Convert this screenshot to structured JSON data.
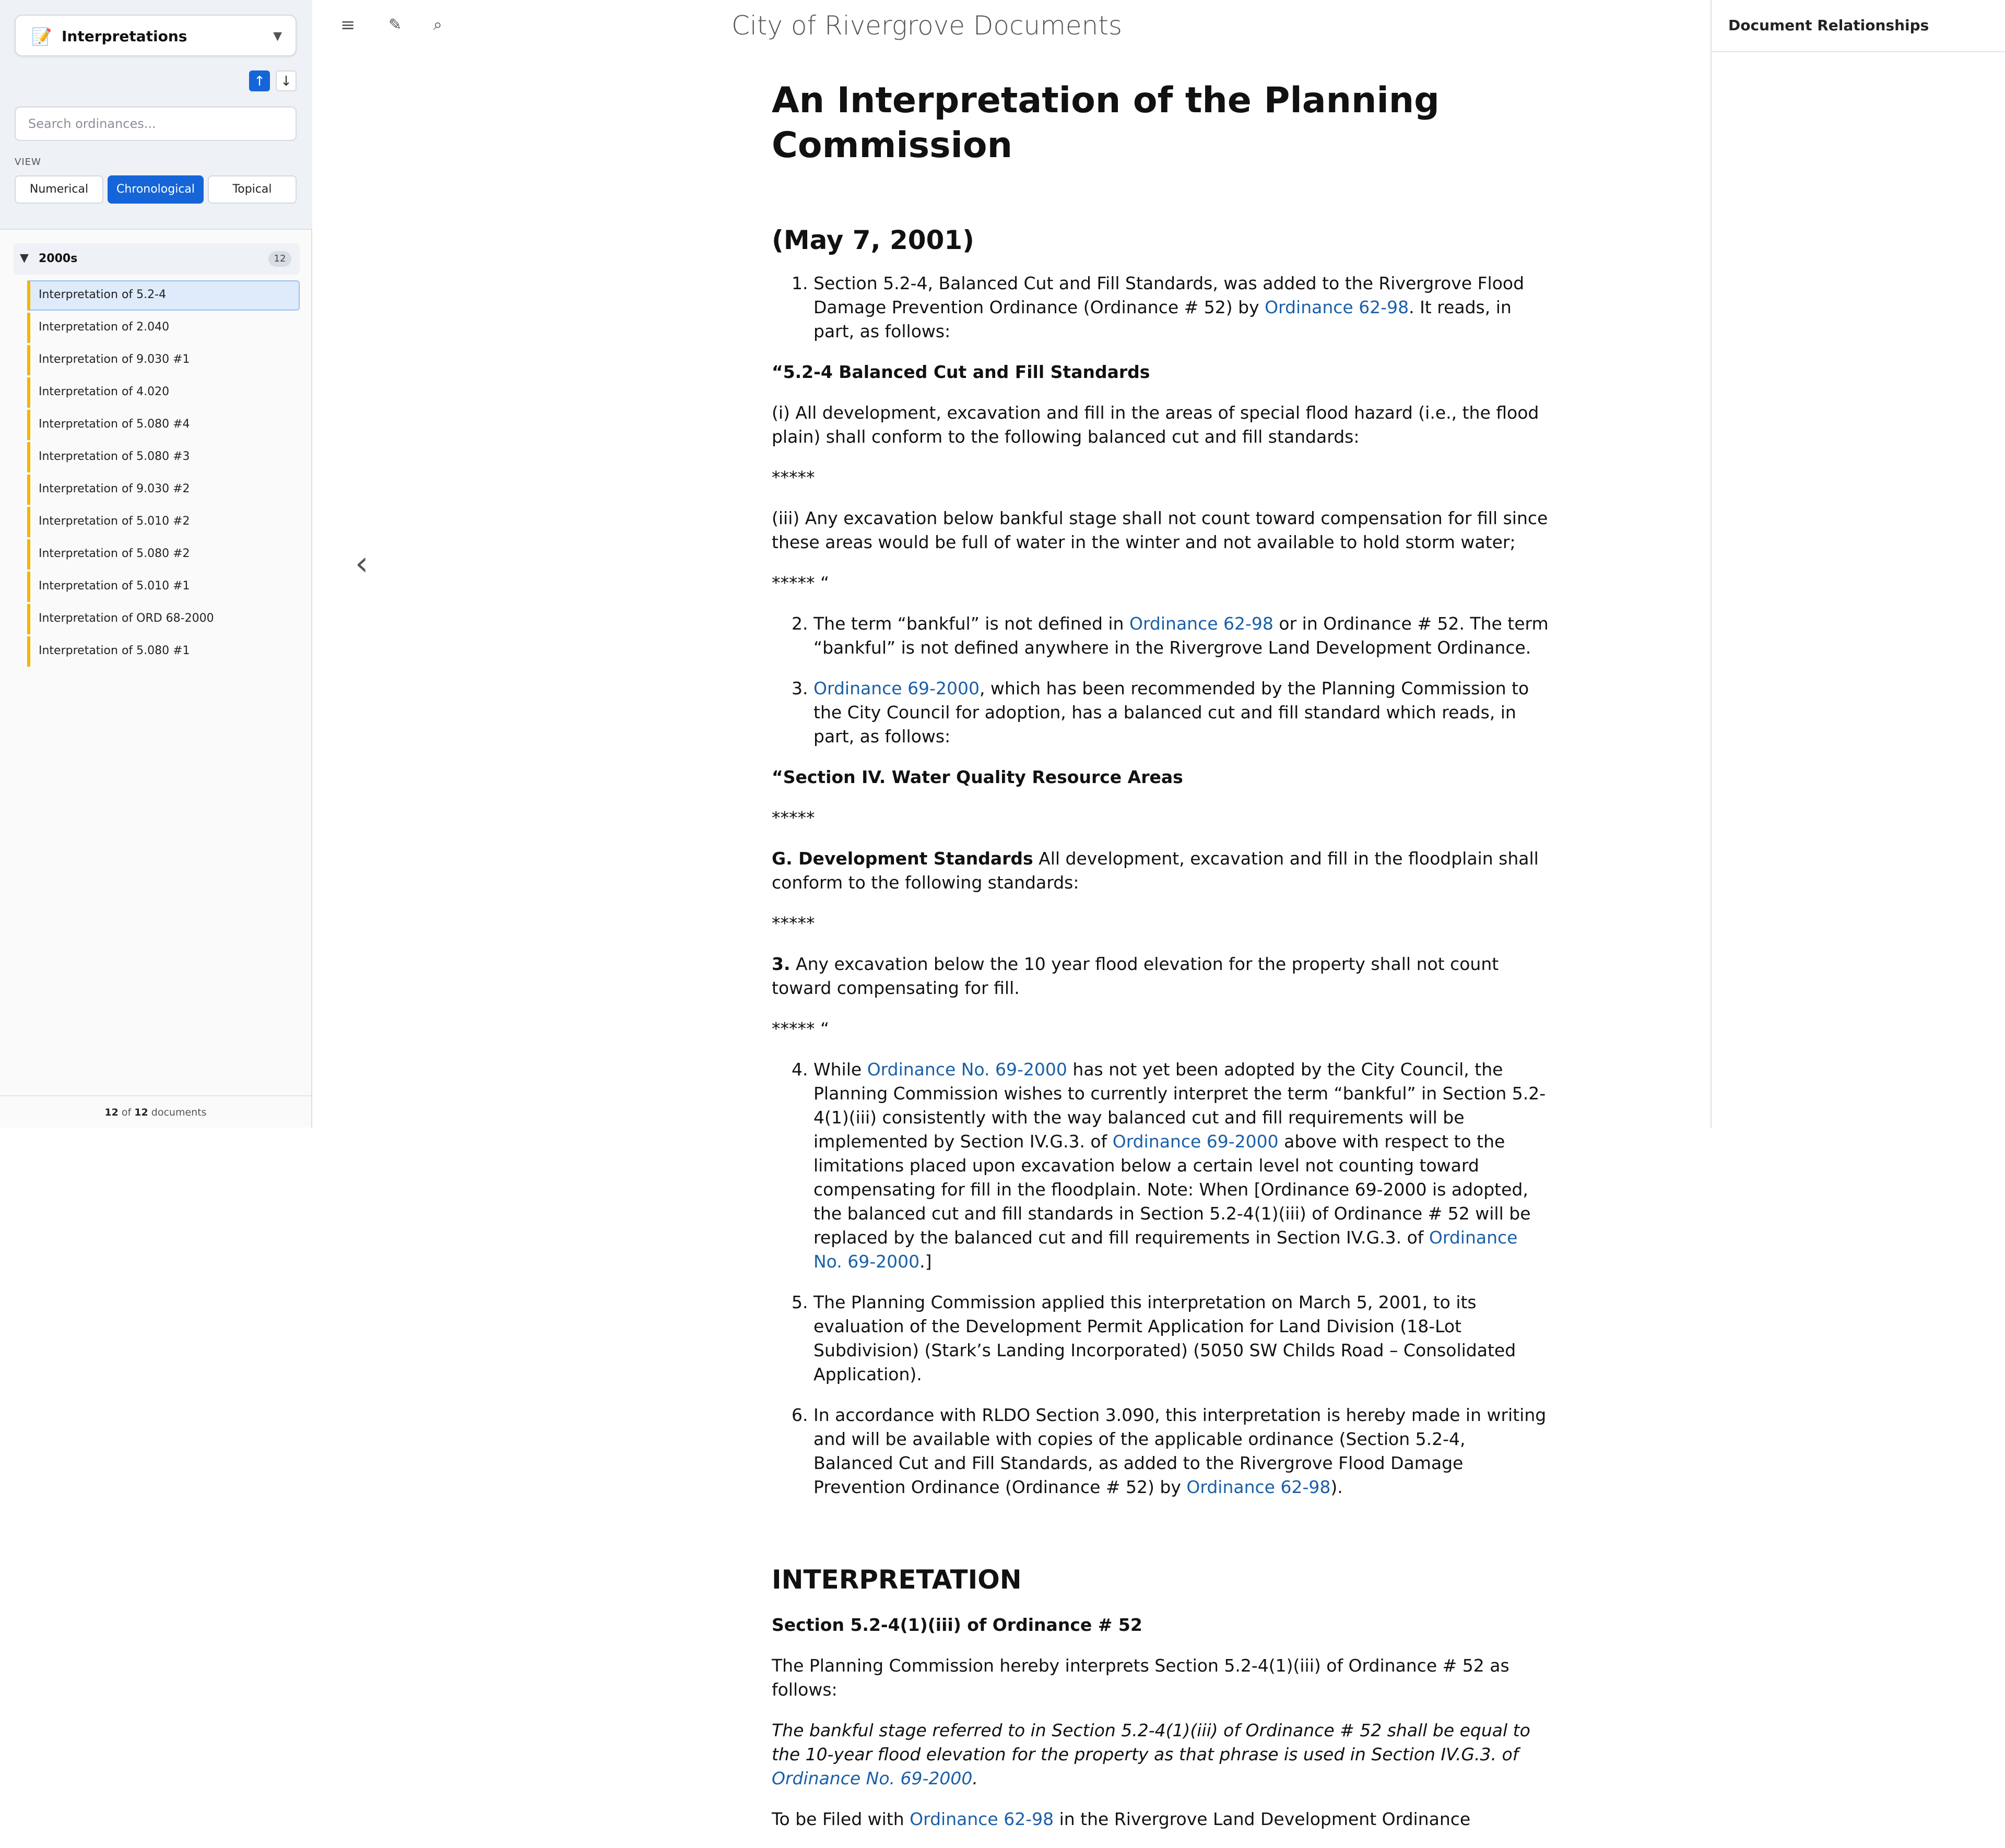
{
  "sidebar": {
    "collection_icon": "📝",
    "collection_label": "Interpretations",
    "caret": "▼",
    "sort_up": "↑",
    "sort_down": "↓",
    "search_placeholder": "Search ordinances...",
    "view_label": "VIEW",
    "view_buttons": [
      "Numerical",
      "Chronological",
      "Topical"
    ],
    "selected_view": "Chronological",
    "group": {
      "triangle": "▼",
      "label": "2000s",
      "count": "12"
    },
    "documents": [
      "Interpretation of 5.2-4",
      "Interpretation of 2.040",
      "Interpretation of 9.030 #1",
      "Interpretation of 4.020",
      "Interpretation of 5.080 #4",
      "Interpretation of 5.080 #3",
      "Interpretation of 9.030 #2",
      "Interpretation of 5.010 #2",
      "Interpretation of 5.080 #2",
      "Interpretation of 5.010 #1",
      "Interpretation of ORD 68-2000",
      "Interpretation of 5.080 #1"
    ],
    "active_document": "Interpretation of 5.2-4",
    "footer": {
      "shown": "12",
      "of": "of",
      "total": "12",
      "suffix": "documents"
    }
  },
  "toolbar": {
    "menu_icon": "≡",
    "brush_icon": "✎",
    "search_icon": "⌕"
  },
  "site_title": "City of Rivergrove Documents",
  "prev_arrow": "‹",
  "document": {
    "title": "An Interpretation of the Planning Commission",
    "date": "(May 7, 2001)",
    "item1_a": "Section 5.2-4, Balanced Cut and Fill Standards, was added to the Rivergrove Flood Damage Prevention Ordinance (Ordinance # 52) by ",
    "item1_link": "Ordinance 62-98",
    "item1_b": ". It reads, in part, as follows:",
    "quote1_heading": "“5.2-4 Balanced Cut and Fill Standards",
    "quote1_p1": "(i) All development, excavation and fill in the areas of special flood hazard (i.e., the flood plain) shall conform to the following balanced cut and fill standards:",
    "stars": "*****",
    "quote1_p2": "(iii) Any excavation below bankful stage shall not count toward compensation for fill since these areas would be full of water in the winter and not available to hold storm water;",
    "stars_close": "***** “",
    "item2_a": "The term “bankful” is not defined in ",
    "item2_link": "Ordinance 62-98",
    "item2_b": " or in Ordinance # 52. The term “bankful” is not defined anywhere in the Rivergrove Land Development Ordinance.",
    "item3_link": "Ordinance 69-2000",
    "item3_b": ", which has been recommended by the Planning Commission to the City Council for adoption, has a balanced cut and fill standard which reads, in part, as follows:",
    "quote2_heading": "“Section IV. Water Quality Resource Areas",
    "quote2_g_bold": "G. Development Standards",
    "quote2_g_rest": " All development, excavation and fill in the floodplain shall conform to the following standards:",
    "quote2_3_bold": "3.",
    "quote2_3_rest": " Any excavation below the 10 year flood elevation for the property shall not count toward compensating for fill.",
    "item4_a": "While ",
    "item4_link1": "Ordinance No. 69-2000",
    "item4_b": " has not yet been adopted by the City Council, the Planning Commission wishes to currently interpret the term “bankful” in Section 5.2-4(1)(iii) consistently with the way balanced cut and fill requirements will be implemented by Section IV.G.3. of ",
    "item4_link2": "Ordinance 69-2000",
    "item4_c": " above with respect to the limitations placed upon excavation below a certain level not counting toward compensating for fill in the floodplain. Note: When [Ordinance 69-2000 is adopted, the balanced cut and fill standards in Section 5.2-4(1)(iii) of Ordinance # 52 will be replaced by the balanced cut and fill requirements in Section IV.G.3. of ",
    "item4_link3": "Ordinance No. 69-2000",
    "item4_d": ".]",
    "item5": "The Planning Commission applied this interpretation on March 5, 2001, to its evaluation of the Development Permit Application for Land Division (18-Lot Subdivision) (Stark’s Landing Incorporated) (5050 SW Childs Road – Consolidated Application).",
    "item6_a": "In accordance with RLDO Section 3.090, this interpretation is hereby made in writing and will be available with copies of the applicable ordinance (Section 5.2-4, Balanced Cut and Fill Standards, as added to the Rivergrove Flood Damage Prevention Ordinance (Ordinance # 52) by ",
    "item6_link": "Ordinance 62-98",
    "item6_b": ").",
    "interp_heading": "INTERPRETATION",
    "interp_sub": "Section 5.2-4(1)(iii) of Ordinance # 52",
    "interp_p1": "The Planning Commission hereby interprets Section 5.2-4(1)(iii) of Ordinance # 52 as follows:",
    "interp_italic_a": "The bankful stage referred to in Section 5.2-4(1)(iii) of Ordinance # 52 shall be equal to the 10-year flood elevation for the property as that phrase is used in Section IV.G.3. of ",
    "interp_italic_link": "Ordinance No. 69-2000",
    "interp_italic_b": ".",
    "filed_a": "To be Filed with ",
    "filed_link": "Ordinance 62-98",
    "filed_b": " in the Rivergrove Land Development Ordinance"
  },
  "right_panel": {
    "title": "Document Relationships"
  },
  "colors": {
    "accent": "#1565d8",
    "link": "#1a5fa8",
    "doc_marker": "#f2b600",
    "active_bg": "#deebfb"
  }
}
